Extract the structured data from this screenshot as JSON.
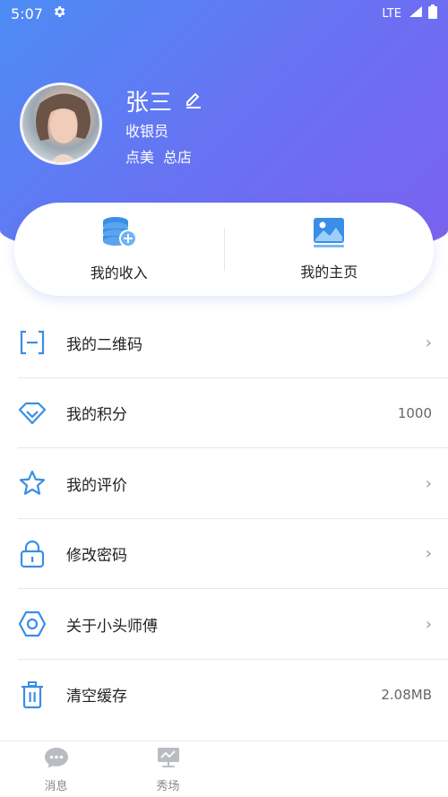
{
  "status_bar": {
    "time": "5:07",
    "network": "LTE"
  },
  "profile": {
    "name": "张三",
    "role": "收银员",
    "store_brand": "点美",
    "store_branch": "总店"
  },
  "cards": [
    {
      "label": "我的收入",
      "icon": "coins-plus-icon"
    },
    {
      "label": "我的主页",
      "icon": "gallery-icon"
    }
  ],
  "menu": [
    {
      "label": "我的二维码",
      "icon": "qrcode-icon",
      "value": "",
      "arrow": true
    },
    {
      "label": "我的积分",
      "icon": "diamond-icon",
      "value": "1000",
      "arrow": false
    },
    {
      "label": "我的评价",
      "icon": "star-icon",
      "value": "",
      "arrow": true
    },
    {
      "label": "修改密码",
      "icon": "lock-icon",
      "value": "",
      "arrow": true
    },
    {
      "label": "关于小头师傅",
      "icon": "hexagon-icon",
      "value": "",
      "arrow": true
    },
    {
      "label": "清空缓存",
      "icon": "trash-icon",
      "value": "2.08MB",
      "arrow": false
    }
  ],
  "tabbar": [
    {
      "label": "消息",
      "icon": "chat-icon"
    },
    {
      "label": "秀场",
      "icon": "presentation-icon"
    }
  ],
  "colors": {
    "accent": "#3a8ee6",
    "header_start": "#4d8cf5",
    "header_end": "#7b62ee"
  }
}
